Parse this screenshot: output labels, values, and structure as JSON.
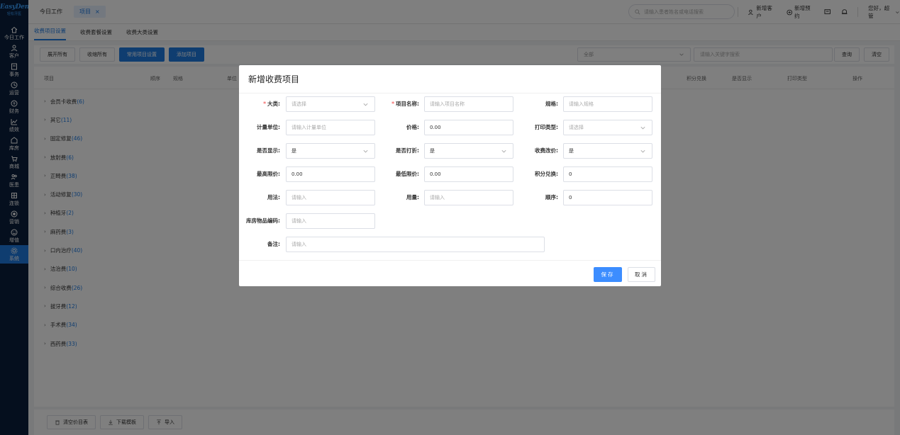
{
  "logo": {
    "main": "EasyDent",
    "sub": "轻松牙医"
  },
  "sidebar": {
    "items": [
      {
        "label": "今日工作",
        "icon": "home-icon"
      },
      {
        "label": "客户",
        "icon": "user-icon"
      },
      {
        "label": "事务",
        "icon": "task-icon"
      },
      {
        "label": "运营",
        "icon": "clock-icon"
      },
      {
        "label": "财务",
        "icon": "finance-icon"
      },
      {
        "label": "绩效",
        "icon": "chart-icon"
      },
      {
        "label": "库房",
        "icon": "warehouse-icon"
      },
      {
        "label": "商城",
        "icon": "cart-icon"
      },
      {
        "label": "医患",
        "icon": "doctor-patient-icon"
      },
      {
        "label": "连锁",
        "icon": "chain-icon"
      },
      {
        "label": "营销",
        "icon": "marketing-icon"
      },
      {
        "label": "增值",
        "icon": "value-added-icon"
      },
      {
        "label": "系统",
        "icon": "gear-icon",
        "active": true
      }
    ]
  },
  "topbar": {
    "tab_today": "今日工作",
    "tab_active": "项目",
    "tab_close": "×",
    "search_placeholder": "请输入患者姓名或电话搜索",
    "new_customer": "新增客户",
    "new_appointment": "新增预约",
    "greeting": "您好，超管"
  },
  "subtabs": [
    "收费项目设置",
    "收费套餐设置",
    "收费大类设置"
  ],
  "toolbar": {
    "expand_all": "展开所有",
    "collapse_all": "收缩所有",
    "common_items": "常用项目设置",
    "add_item": "添加项目",
    "select_value": "全部",
    "keyword_placeholder": "请输入关键字搜索",
    "query": "查询",
    "clear": "清空"
  },
  "table": {
    "headers": {
      "item": "项目",
      "order": "顺序",
      "spec": "规格",
      "unit": "单位",
      "points": "积分兑换",
      "show": "是否显示",
      "print_type": "打印类型",
      "ops": "操作"
    },
    "rows": [
      {
        "name": "会员卡收费",
        "count": "(6)"
      },
      {
        "name": "其它",
        "count": "(11)"
      },
      {
        "name": "固定修复",
        "count": "(46)"
      },
      {
        "name": "放射费",
        "count": "(6)"
      },
      {
        "name": "正畸费",
        "count": "(38)"
      },
      {
        "name": "活动修复",
        "count": "(30)"
      },
      {
        "name": "种植牙",
        "count": "(2)"
      },
      {
        "name": "麻药费",
        "count": "(3)"
      },
      {
        "name": "口内治疗",
        "count": "(40)"
      },
      {
        "name": "洁治费",
        "count": "(10)"
      },
      {
        "name": "综合收费",
        "count": "(26)"
      },
      {
        "name": "拔牙费",
        "count": "(12)"
      },
      {
        "name": "手术费",
        "count": "(34)"
      },
      {
        "name": "西药费",
        "count": "(33)"
      }
    ]
  },
  "footer": {
    "clear_list": "清空价目表",
    "download_template": "下载模板",
    "import": "导入"
  },
  "dialog": {
    "title": "新增收费项目",
    "fields": {
      "category": {
        "label": "大类:",
        "placeholder": "请选择",
        "required": true
      },
      "name": {
        "label": "项目名称:",
        "placeholder": "请输入项目名称",
        "required": true
      },
      "spec": {
        "label": "规格:",
        "placeholder": "请输入规格"
      },
      "unit": {
        "label": "计量单位:",
        "placeholder": "请输入计量单位"
      },
      "price": {
        "label": "价格:",
        "value": "0.00"
      },
      "print_type": {
        "label": "打印类型:",
        "placeholder": "请选择"
      },
      "show": {
        "label": "是否显示:",
        "value": "是"
      },
      "discount": {
        "label": "是否打折:",
        "value": "是"
      },
      "change_price": {
        "label": "收费改价:",
        "value": "是"
      },
      "max_price": {
        "label": "最高限价:",
        "value": "0.00"
      },
      "min_price": {
        "label": "最低限价:",
        "value": "0.00"
      },
      "points": {
        "label": "积分兑换:",
        "value": "0"
      },
      "usage": {
        "label": "用法:",
        "placeholder": "请输入"
      },
      "dosage": {
        "label": "用量:",
        "placeholder": "请输入"
      },
      "order": {
        "label": "顺序:",
        "value": "0"
      },
      "stock_code": {
        "label": "库房物品编码:",
        "placeholder": "请输入"
      },
      "remark": {
        "label": "备注:",
        "placeholder": "请输入"
      }
    },
    "save": "保存",
    "cancel": "取消"
  },
  "colors": {
    "primary": "#1f7ae0",
    "sidebar": "#0a1f3c",
    "required": "#f56c6c"
  }
}
